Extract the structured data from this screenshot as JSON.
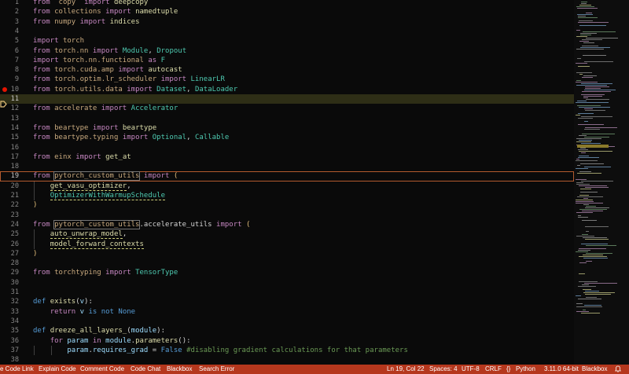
{
  "editor": {
    "active_line": 11,
    "lines": [
      {
        "n": "1",
        "t": [
          [
            "kw",
            "from"
          ],
          [
            "",
            "  "
          ],
          [
            "mod",
            "copy"
          ],
          [
            "",
            "  "
          ],
          [
            "kw",
            "import"
          ],
          [
            "",
            " "
          ],
          [
            "fn",
            "deepcopy"
          ]
        ]
      },
      {
        "n": "2",
        "t": [
          [
            "kw",
            "from"
          ],
          [
            "",
            " "
          ],
          [
            "mod",
            "collections"
          ],
          [
            "",
            " "
          ],
          [
            "kw",
            "import"
          ],
          [
            "",
            " "
          ],
          [
            "fn",
            "namedtuple"
          ]
        ]
      },
      {
        "n": "3",
        "t": [
          [
            "kw",
            "from"
          ],
          [
            "",
            " "
          ],
          [
            "mod",
            "numpy"
          ],
          [
            "",
            " "
          ],
          [
            "kw",
            "import"
          ],
          [
            "",
            " "
          ],
          [
            "fn",
            "indices"
          ]
        ]
      },
      {
        "n": "4",
        "t": []
      },
      {
        "n": "5",
        "t": [
          [
            "kw",
            "import"
          ],
          [
            "",
            " "
          ],
          [
            "mod",
            "torch"
          ]
        ]
      },
      {
        "n": "6",
        "t": [
          [
            "kw",
            "from"
          ],
          [
            "",
            " "
          ],
          [
            "mod",
            "torch.nn"
          ],
          [
            "",
            " "
          ],
          [
            "kw",
            "import"
          ],
          [
            "",
            " "
          ],
          [
            "cls",
            "Module"
          ],
          [
            ", "
          ],
          [
            "cls",
            "Dropout"
          ]
        ]
      },
      {
        "n": "7",
        "t": [
          [
            "kw",
            "import"
          ],
          [
            "",
            " "
          ],
          [
            "mod",
            "torch.nn.functional"
          ],
          [
            "",
            " "
          ],
          [
            "kw",
            "as"
          ],
          [
            "",
            " "
          ],
          [
            "cls",
            "F"
          ]
        ]
      },
      {
        "n": "8",
        "t": [
          [
            "kw",
            "from"
          ],
          [
            "",
            " "
          ],
          [
            "mod",
            "torch.cuda.amp"
          ],
          [
            "",
            " "
          ],
          [
            "kw",
            "import"
          ],
          [
            "",
            " "
          ],
          [
            "fn",
            "autocast"
          ]
        ]
      },
      {
        "n": "9",
        "t": [
          [
            "kw",
            "from"
          ],
          [
            "",
            " "
          ],
          [
            "mod",
            "torch.optim.lr_scheduler"
          ],
          [
            "",
            " "
          ],
          [
            "kw",
            "import"
          ],
          [
            "",
            " "
          ],
          [
            "cls",
            "LinearLR"
          ]
        ]
      },
      {
        "n": "10",
        "t": [
          [
            "kw",
            "from"
          ],
          [
            "",
            " "
          ],
          [
            "mod",
            "torch.utils.data"
          ],
          [
            "",
            " "
          ],
          [
            "kw",
            "import"
          ],
          [
            "",
            " "
          ],
          [
            "cls",
            "Dataset"
          ],
          [
            "",
            ", "
          ],
          [
            "cls",
            "DataLoader"
          ]
        ]
      },
      {
        "n": "11",
        "t": []
      },
      {
        "n": "12",
        "t": [
          [
            "kw",
            "from"
          ],
          [
            "",
            " "
          ],
          [
            "mod",
            "accelerate"
          ],
          [
            "",
            " "
          ],
          [
            "kw",
            "import"
          ],
          [
            "",
            " "
          ],
          [
            "cls",
            "Accelerator"
          ]
        ]
      },
      {
        "n": "13",
        "t": []
      },
      {
        "n": "14",
        "t": [
          [
            "kw",
            "from"
          ],
          [
            "",
            " "
          ],
          [
            "mod",
            "beartype"
          ],
          [
            "",
            " "
          ],
          [
            "kw",
            "import"
          ],
          [
            "",
            " "
          ],
          [
            "fn",
            "beartype"
          ]
        ]
      },
      {
        "n": "15",
        "t": [
          [
            "kw",
            "from"
          ],
          [
            "",
            " "
          ],
          [
            "mod",
            "beartype.typing"
          ],
          [
            "",
            " "
          ],
          [
            "kw",
            "import"
          ],
          [
            "",
            " "
          ],
          [
            "cls",
            "Optional"
          ],
          [
            "",
            ", "
          ],
          [
            "cls",
            "Callable"
          ]
        ]
      },
      {
        "n": "16",
        "t": []
      },
      {
        "n": "17",
        "t": [
          [
            "kw",
            "from"
          ],
          [
            "",
            " "
          ],
          [
            "mod",
            "einx"
          ],
          [
            "",
            " "
          ],
          [
            "kw",
            "import"
          ],
          [
            "",
            " "
          ],
          [
            "fn",
            "get_at"
          ]
        ]
      },
      {
        "n": "18",
        "t": []
      },
      {
        "n": "19",
        "t": [
          [
            "kw",
            "from"
          ],
          [
            "",
            " "
          ],
          [
            "mod pbox",
            "pytorch_custom_utils"
          ],
          [
            "",
            " "
          ],
          [
            "kw",
            "import"
          ],
          [
            "",
            " "
          ],
          [
            "brace",
            "("
          ]
        ]
      },
      {
        "n": "20",
        "t": [
          [
            "",
            "    "
          ],
          [
            "fn ul",
            "get_vasu_optimizer"
          ],
          [
            "",
            ","
          ]
        ]
      },
      {
        "n": "21",
        "t": [
          [
            "",
            "    "
          ],
          [
            "cls ul",
            "OptimizerWithWarmupSchedule"
          ]
        ]
      },
      {
        "n": "22",
        "t": [
          [
            "brace",
            ")"
          ]
        ]
      },
      {
        "n": "23",
        "t": []
      },
      {
        "n": "24",
        "t": [
          [
            "kw",
            "from"
          ],
          [
            "",
            " "
          ],
          [
            "mod pbox",
            "pytorch_custom_utils"
          ],
          [
            "",
            ".accelerate_utils "
          ],
          [
            "kw",
            "import"
          ],
          [
            "",
            " "
          ],
          [
            "brace",
            "("
          ]
        ]
      },
      {
        "n": "25",
        "t": [
          [
            "",
            "    "
          ],
          [
            "fn ul",
            "auto_unwrap_model"
          ],
          [
            "",
            ","
          ]
        ]
      },
      {
        "n": "26",
        "t": [
          [
            "",
            "    "
          ],
          [
            "fn ul",
            "model_forward_contexts"
          ]
        ]
      },
      {
        "n": "27",
        "t": [
          [
            "brace",
            ")"
          ]
        ]
      },
      {
        "n": "28",
        "t": []
      },
      {
        "n": "29",
        "t": [
          [
            "kw",
            "from"
          ],
          [
            "",
            " "
          ],
          [
            "mod",
            "torchtyping"
          ],
          [
            "",
            " "
          ],
          [
            "kw",
            "import"
          ],
          [
            "",
            " "
          ],
          [
            "cls",
            "TensorType"
          ]
        ]
      },
      {
        "n": "30",
        "t": []
      },
      {
        "n": "31",
        "t": []
      },
      {
        "n": "32",
        "t": [
          [
            "kw2",
            "def"
          ],
          [
            "",
            " "
          ],
          [
            "fn",
            "exists"
          ],
          [
            "",
            "("
          ],
          [
            "var",
            "v"
          ],
          [
            "",
            "):"
          ]
        ]
      },
      {
        "n": "33",
        "t": [
          [
            "",
            "    "
          ],
          [
            "kw",
            "return"
          ],
          [
            "",
            " "
          ],
          [
            "var",
            "v"
          ],
          [
            "",
            " "
          ],
          [
            "kw2",
            "is not"
          ],
          [
            "",
            " "
          ],
          [
            "kw2",
            "None"
          ]
        ]
      },
      {
        "n": "34",
        "t": []
      },
      {
        "n": "35",
        "t": [
          [
            "kw2",
            "def"
          ],
          [
            "",
            " "
          ],
          [
            "fn",
            "dreeze_all_layers_"
          ],
          [
            "",
            "("
          ],
          [
            "var",
            "module"
          ],
          [
            "",
            "):"
          ]
        ]
      },
      {
        "n": "36",
        "t": [
          [
            "",
            "    "
          ],
          [
            "kw",
            "for"
          ],
          [
            "",
            " "
          ],
          [
            "var",
            "param"
          ],
          [
            "",
            " "
          ],
          [
            "kw",
            "in"
          ],
          [
            "",
            " "
          ],
          [
            "var",
            "module"
          ],
          [
            "",
            "."
          ],
          [
            "fn",
            "parameters"
          ],
          [
            "",
            "():"
          ]
        ]
      },
      {
        "n": "37",
        "t": [
          [
            "",
            "        "
          ],
          [
            "var",
            "param"
          ],
          [
            "",
            "."
          ],
          [
            "var",
            "requires_grad"
          ],
          [
            "",
            " = "
          ],
          [
            "kw2",
            "False"
          ],
          [
            "",
            " "
          ],
          [
            "cmt",
            "#disabling gradient calculations for that parameters"
          ]
        ]
      },
      {
        "n": "38",
        "t": []
      }
    ]
  },
  "status": {
    "items_left": [
      "e Code Link",
      "Explain Code",
      "Comment Code",
      "Code Chat",
      "Blackbox",
      "Search Error"
    ],
    "items_right": [
      "Ln 19, Col 22",
      "Spaces: 4",
      "UTF-8",
      "CRLF",
      "Python",
      "3.11.0 64-bit",
      "Blackbox"
    ],
    "colors": {
      "bar": "#b5371d"
    }
  }
}
